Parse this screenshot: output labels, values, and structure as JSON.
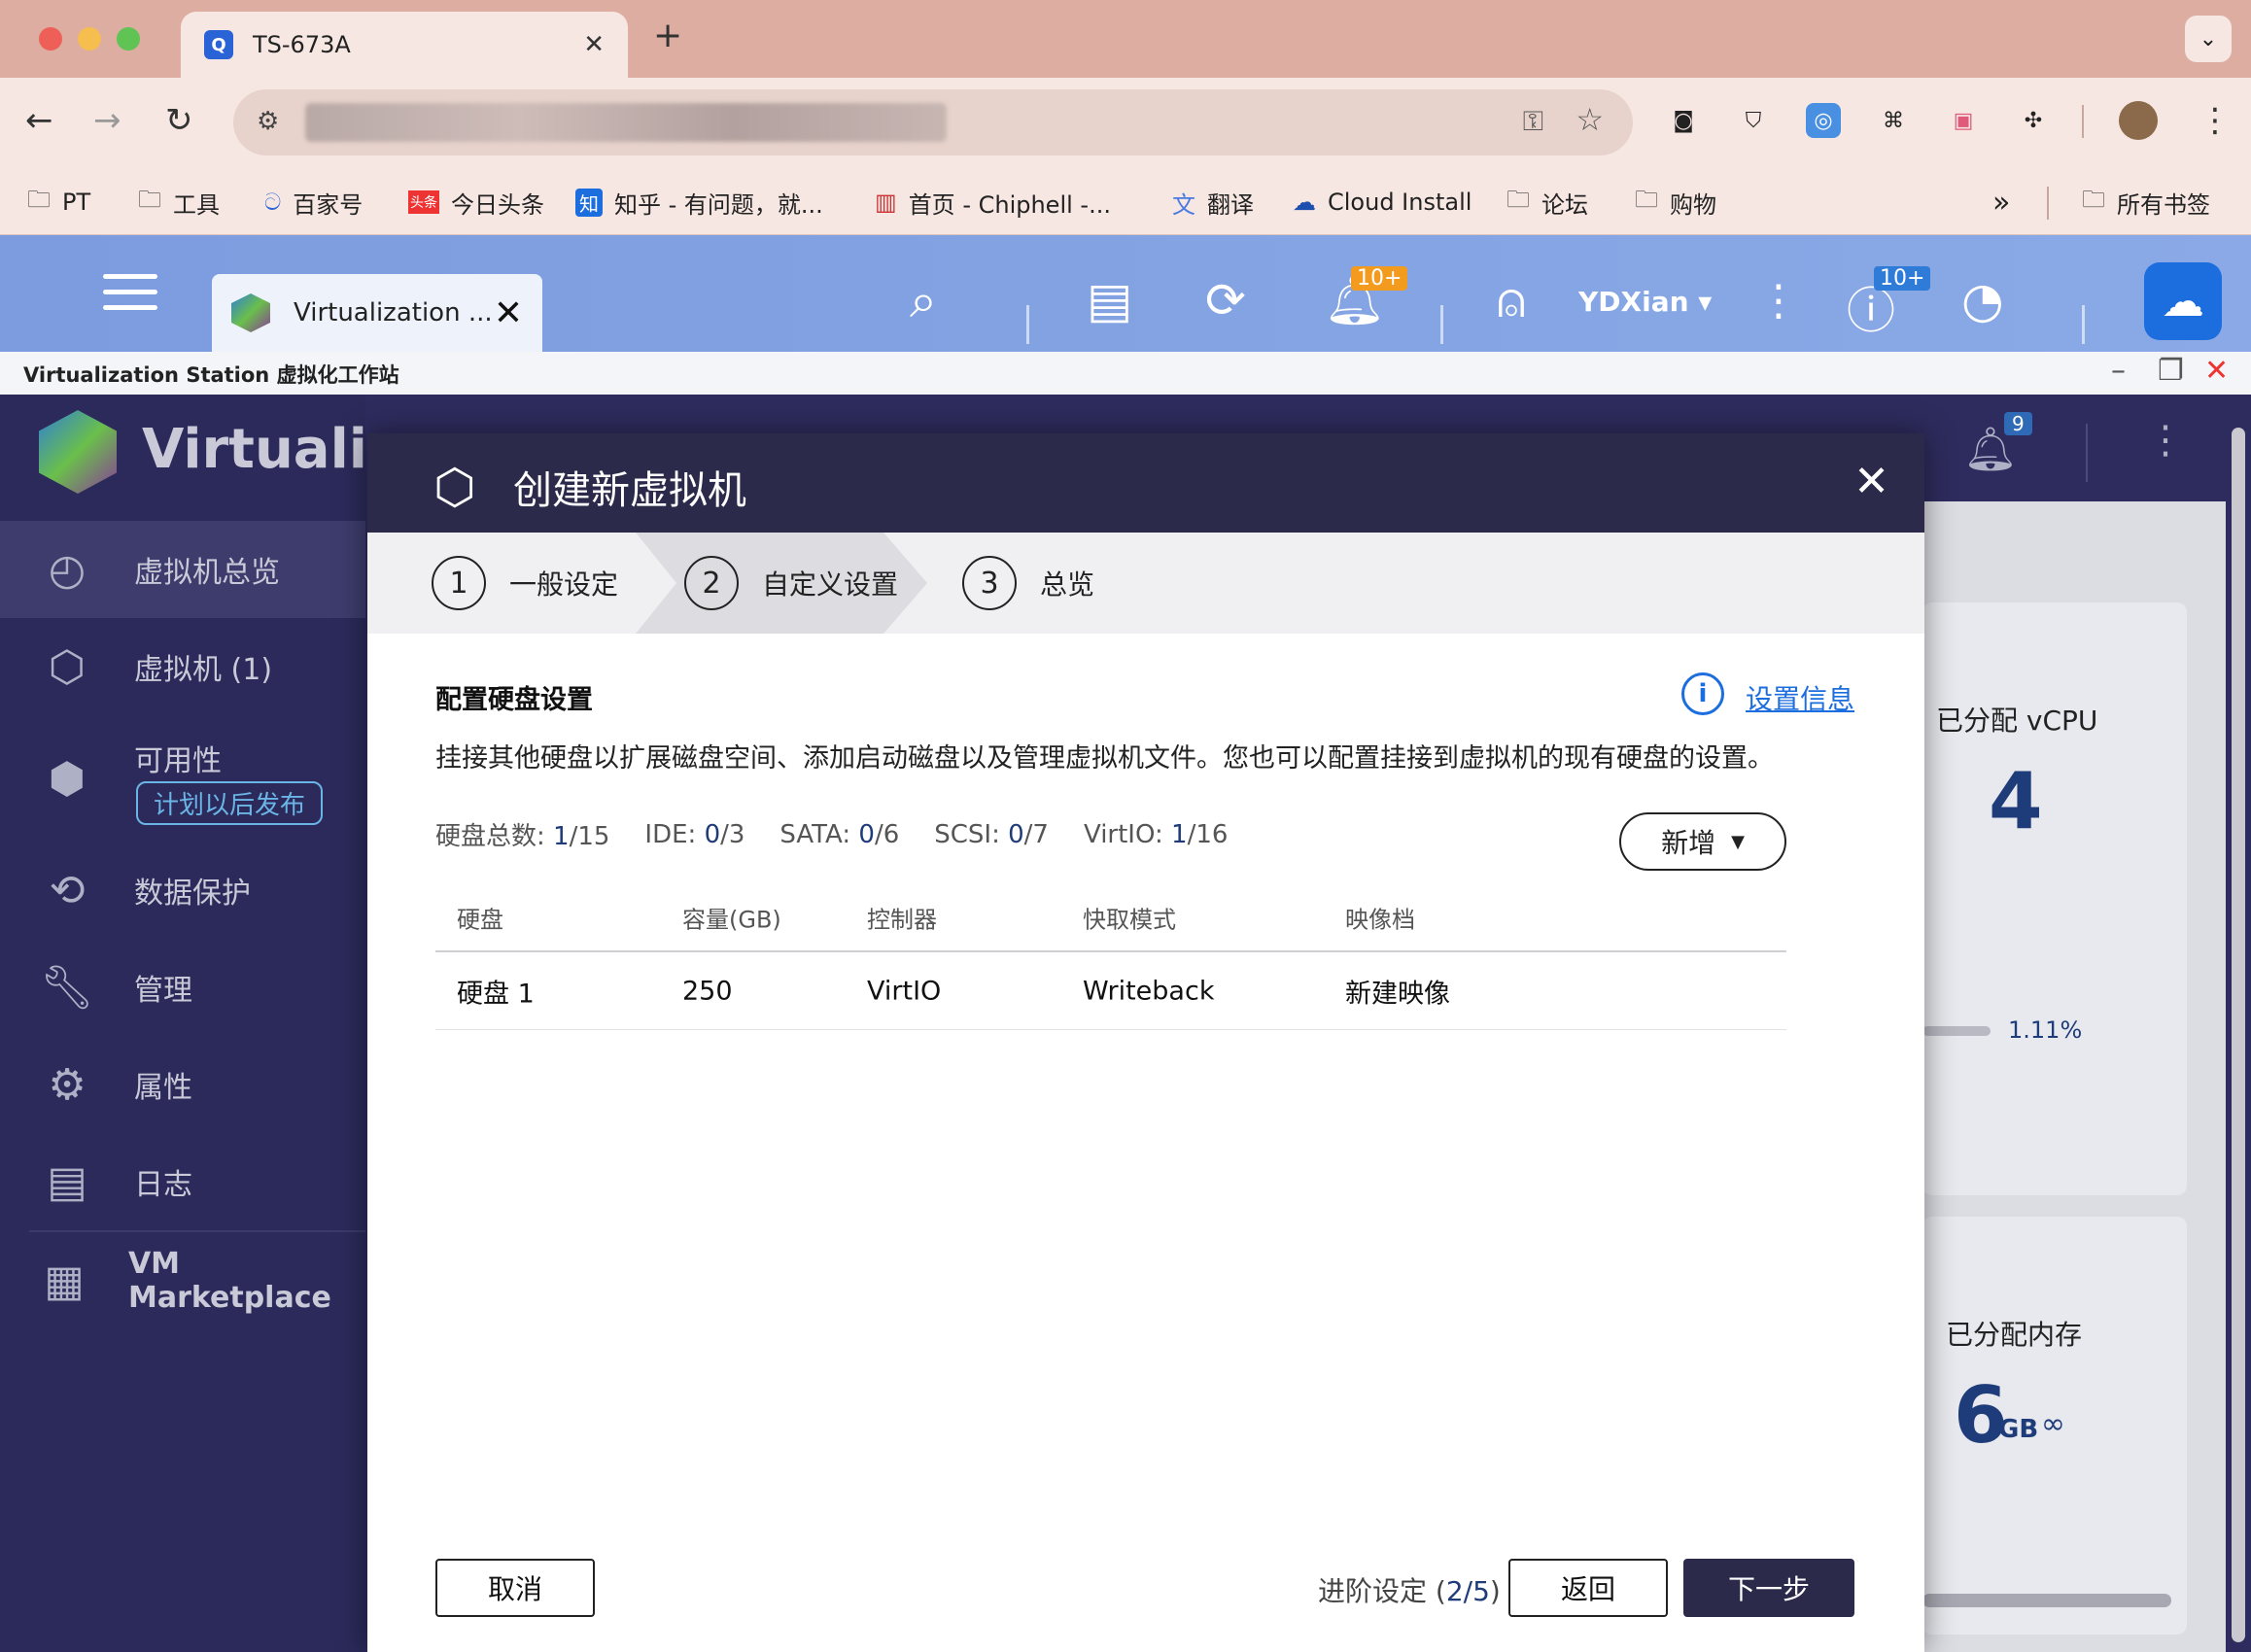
{
  "browser": {
    "tab_title": "TS-673A",
    "bookmarks": [
      "PT",
      "工具",
      "百家号",
      "今日头条",
      "知乎 - 有问题，就...",
      "首页 - Chiphell -...",
      "翻译",
      "Cloud Install",
      "论坛",
      "购物"
    ],
    "all_bookmarks": "所有书签",
    "more": "»"
  },
  "qts": {
    "app_tab": "Virtualization ...",
    "notif_badge": "10+",
    "user": "YDXian ▾",
    "info_badge": "10+",
    "window_title": "Virtualization Station 虚拟化工作站"
  },
  "app": {
    "logo_text": "Virtualiza",
    "header_badge": "9",
    "sidebar": [
      {
        "icon": "dashboard-icon",
        "label": "虚拟机总览"
      },
      {
        "icon": "vm-icon",
        "label": "虚拟机 (1)"
      },
      {
        "icon": "availability-icon",
        "label": "可用性"
      },
      {
        "icon": "data-protection-icon",
        "label": "数据保护"
      },
      {
        "icon": "wrench-icon",
        "label": "管理"
      },
      {
        "icon": "gear-icon",
        "label": "属性"
      },
      {
        "icon": "log-icon",
        "label": "日志"
      },
      {
        "icon": "marketplace-icon",
        "label": "VM Marketplace"
      }
    ],
    "availability_tag": "计划以后发布",
    "right": {
      "vcpu_label": "已分配 vCPU",
      "vcpu_value": "4",
      "cpu_pct": "1.11%",
      "mem_label": "已分配内存",
      "mem_value": "6",
      "mem_unit": "GB"
    }
  },
  "modal": {
    "title": "创建新虚拟机",
    "steps": [
      {
        "num": "1",
        "label": "一般设定"
      },
      {
        "num": "2",
        "label": "自定义设置"
      },
      {
        "num": "3",
        "label": "总览"
      }
    ],
    "section_title": "配置硬盘设置",
    "info_link": "设置信息",
    "description": "挂接其他硬盘以扩展磁盘空间、添加启动磁盘以及管理虚拟机文件。您也可以配置挂接到虚拟机的现有硬盘的设置。",
    "counts": [
      {
        "label": "硬盘总数: ",
        "used": "1",
        "total": "/15"
      },
      {
        "label": "IDE: ",
        "used": "0",
        "total": "/3"
      },
      {
        "label": "SATA: ",
        "used": "0",
        "total": "/6"
      },
      {
        "label": "SCSI: ",
        "used": "0",
        "total": "/7"
      },
      {
        "label": "VirtIO: ",
        "used": "1",
        "total": "/16"
      }
    ],
    "add_button": "新增",
    "columns": [
      "硬盘",
      "容量(GB)",
      "控制器",
      "快取模式",
      "映像档"
    ],
    "rows": [
      [
        "硬盘 1",
        "250",
        "VirtIO",
        "Writeback",
        "新建映像"
      ]
    ],
    "cancel": "取消",
    "progress_label": "进阶设定 (",
    "progress_value": "2/5",
    "progress_close": ")",
    "back": "返回",
    "next": "下一步"
  }
}
